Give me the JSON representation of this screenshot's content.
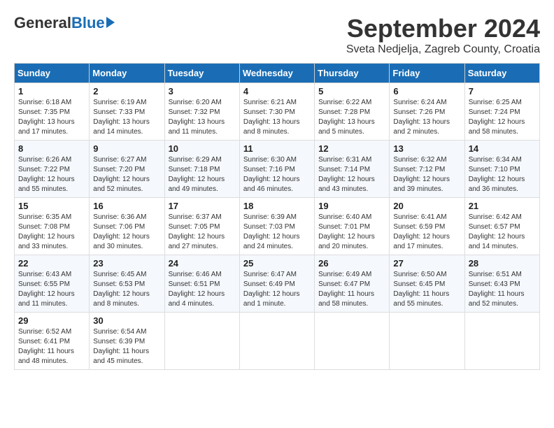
{
  "header": {
    "logo_general": "General",
    "logo_blue": "Blue",
    "month_title": "September 2024",
    "location": "Sveta Nedjelja, Zagreb County, Croatia"
  },
  "days_of_week": [
    "Sunday",
    "Monday",
    "Tuesday",
    "Wednesday",
    "Thursday",
    "Friday",
    "Saturday"
  ],
  "weeks": [
    [
      {
        "day": "1",
        "info": "Sunrise: 6:18 AM\nSunset: 7:35 PM\nDaylight: 13 hours and 17 minutes."
      },
      {
        "day": "2",
        "info": "Sunrise: 6:19 AM\nSunset: 7:33 PM\nDaylight: 13 hours and 14 minutes."
      },
      {
        "day": "3",
        "info": "Sunrise: 6:20 AM\nSunset: 7:32 PM\nDaylight: 13 hours and 11 minutes."
      },
      {
        "day": "4",
        "info": "Sunrise: 6:21 AM\nSunset: 7:30 PM\nDaylight: 13 hours and 8 minutes."
      },
      {
        "day": "5",
        "info": "Sunrise: 6:22 AM\nSunset: 7:28 PM\nDaylight: 13 hours and 5 minutes."
      },
      {
        "day": "6",
        "info": "Sunrise: 6:24 AM\nSunset: 7:26 PM\nDaylight: 13 hours and 2 minutes."
      },
      {
        "day": "7",
        "info": "Sunrise: 6:25 AM\nSunset: 7:24 PM\nDaylight: 12 hours and 58 minutes."
      }
    ],
    [
      {
        "day": "8",
        "info": "Sunrise: 6:26 AM\nSunset: 7:22 PM\nDaylight: 12 hours and 55 minutes."
      },
      {
        "day": "9",
        "info": "Sunrise: 6:27 AM\nSunset: 7:20 PM\nDaylight: 12 hours and 52 minutes."
      },
      {
        "day": "10",
        "info": "Sunrise: 6:29 AM\nSunset: 7:18 PM\nDaylight: 12 hours and 49 minutes."
      },
      {
        "day": "11",
        "info": "Sunrise: 6:30 AM\nSunset: 7:16 PM\nDaylight: 12 hours and 46 minutes."
      },
      {
        "day": "12",
        "info": "Sunrise: 6:31 AM\nSunset: 7:14 PM\nDaylight: 12 hours and 43 minutes."
      },
      {
        "day": "13",
        "info": "Sunrise: 6:32 AM\nSunset: 7:12 PM\nDaylight: 12 hours and 39 minutes."
      },
      {
        "day": "14",
        "info": "Sunrise: 6:34 AM\nSunset: 7:10 PM\nDaylight: 12 hours and 36 minutes."
      }
    ],
    [
      {
        "day": "15",
        "info": "Sunrise: 6:35 AM\nSunset: 7:08 PM\nDaylight: 12 hours and 33 minutes."
      },
      {
        "day": "16",
        "info": "Sunrise: 6:36 AM\nSunset: 7:06 PM\nDaylight: 12 hours and 30 minutes."
      },
      {
        "day": "17",
        "info": "Sunrise: 6:37 AM\nSunset: 7:05 PM\nDaylight: 12 hours and 27 minutes."
      },
      {
        "day": "18",
        "info": "Sunrise: 6:39 AM\nSunset: 7:03 PM\nDaylight: 12 hours and 24 minutes."
      },
      {
        "day": "19",
        "info": "Sunrise: 6:40 AM\nSunset: 7:01 PM\nDaylight: 12 hours and 20 minutes."
      },
      {
        "day": "20",
        "info": "Sunrise: 6:41 AM\nSunset: 6:59 PM\nDaylight: 12 hours and 17 minutes."
      },
      {
        "day": "21",
        "info": "Sunrise: 6:42 AM\nSunset: 6:57 PM\nDaylight: 12 hours and 14 minutes."
      }
    ],
    [
      {
        "day": "22",
        "info": "Sunrise: 6:43 AM\nSunset: 6:55 PM\nDaylight: 12 hours and 11 minutes."
      },
      {
        "day": "23",
        "info": "Sunrise: 6:45 AM\nSunset: 6:53 PM\nDaylight: 12 hours and 8 minutes."
      },
      {
        "day": "24",
        "info": "Sunrise: 6:46 AM\nSunset: 6:51 PM\nDaylight: 12 hours and 4 minutes."
      },
      {
        "day": "25",
        "info": "Sunrise: 6:47 AM\nSunset: 6:49 PM\nDaylight: 12 hours and 1 minute."
      },
      {
        "day": "26",
        "info": "Sunrise: 6:49 AM\nSunset: 6:47 PM\nDaylight: 11 hours and 58 minutes."
      },
      {
        "day": "27",
        "info": "Sunrise: 6:50 AM\nSunset: 6:45 PM\nDaylight: 11 hours and 55 minutes."
      },
      {
        "day": "28",
        "info": "Sunrise: 6:51 AM\nSunset: 6:43 PM\nDaylight: 11 hours and 52 minutes."
      }
    ],
    [
      {
        "day": "29",
        "info": "Sunrise: 6:52 AM\nSunset: 6:41 PM\nDaylight: 11 hours and 48 minutes."
      },
      {
        "day": "30",
        "info": "Sunrise: 6:54 AM\nSunset: 6:39 PM\nDaylight: 11 hours and 45 minutes."
      },
      {
        "day": "",
        "info": ""
      },
      {
        "day": "",
        "info": ""
      },
      {
        "day": "",
        "info": ""
      },
      {
        "day": "",
        "info": ""
      },
      {
        "day": "",
        "info": ""
      }
    ]
  ]
}
